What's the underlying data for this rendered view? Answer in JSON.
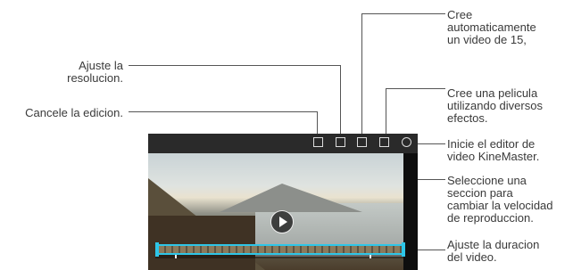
{
  "callouts": {
    "auto_video": "Cree\nautomaticamente\nun video de 15,",
    "resolution": "Ajuste la\nresolucion.",
    "movie": "Cree una pelicula\nutilizando diversos\nefectos.",
    "cancel": "Cancele la edicion.",
    "kinemaster": "Inicie el editor de\nvideo KineMaster.",
    "speed": "Seleccione una\nseccion para\ncambiar la velocidad\nde reproduccion.",
    "duration": "Ajuste la duracion\ndel video."
  },
  "screen": {
    "toolbar_icons": [
      "cancel-icon",
      "resolution-icon",
      "highlight-icon",
      "movie-icon",
      "kinemaster-icon"
    ]
  },
  "colors": {
    "trim_accent": "#2ec6e8"
  }
}
